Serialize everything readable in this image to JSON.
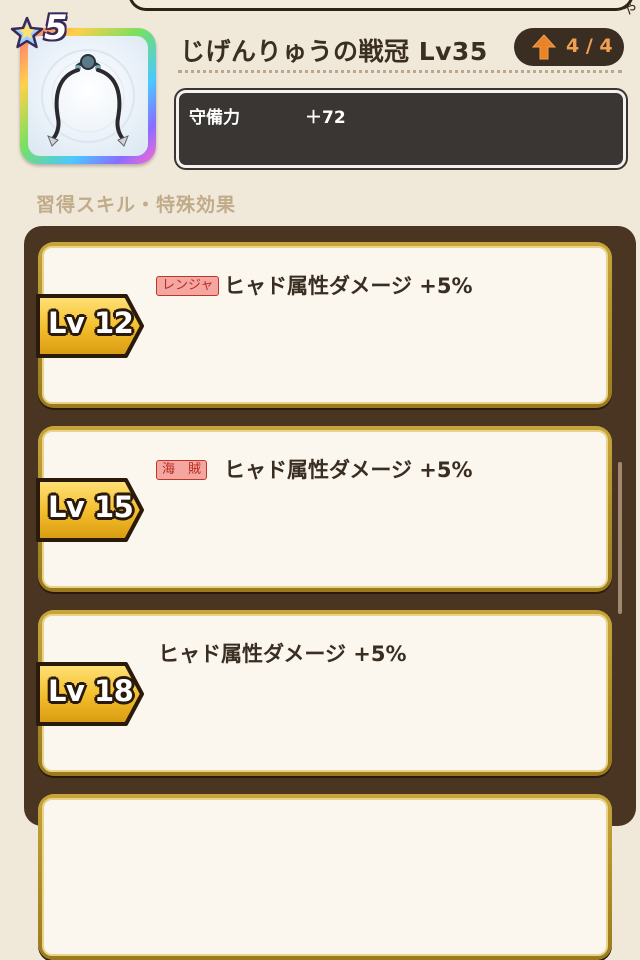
{
  "item": {
    "rarity": "5",
    "name": "じげんりゅうの戦冠 Lv35",
    "upgrade": "4 / 4",
    "stat_label": "守備力",
    "stat_value": "＋72"
  },
  "section_title": "習得スキル・特殊効果",
  "skills": [
    {
      "level": "Lv 12",
      "job_tag": "レンジャ",
      "effect": "ヒャド属性ダメージ +5%"
    },
    {
      "level": "Lv 15",
      "job_tag": "海　賊",
      "effect": "ヒャド属性ダメージ +5%"
    },
    {
      "level": "Lv 18",
      "job_tag": "",
      "effect": "ヒャド属性ダメージ +5%"
    }
  ],
  "colors": {
    "background": "#f0e8d8",
    "panel": "#4a3422",
    "gold_frame": "#c7a53a",
    "stats_box": "#393633",
    "upgrade_text": "#f0a050",
    "job_tag_bg": "#f4a6a0"
  }
}
